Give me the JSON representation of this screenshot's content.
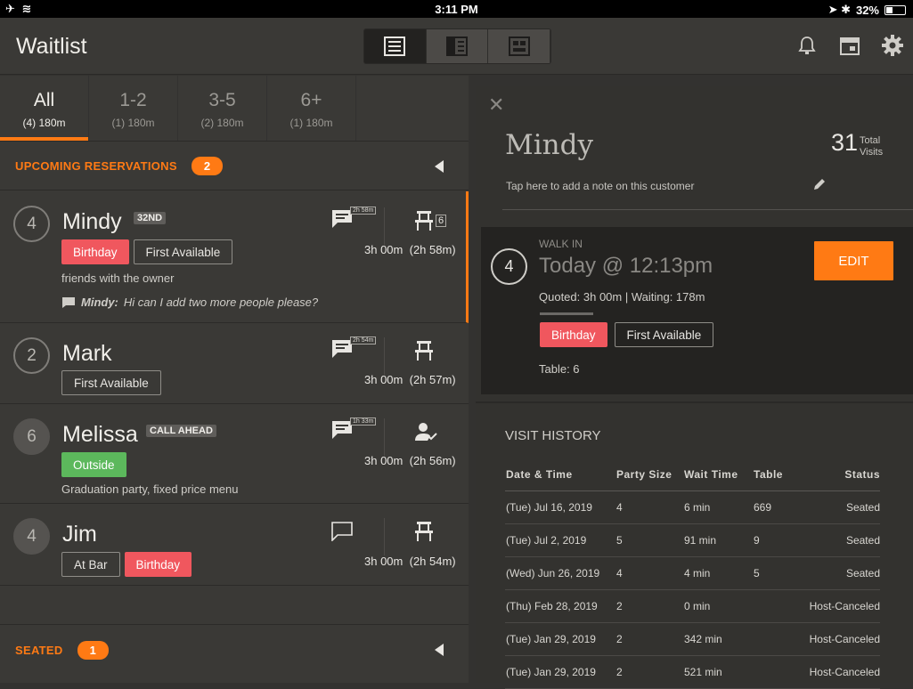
{
  "status_bar": {
    "time": "3:11 PM",
    "battery": "32%"
  },
  "header": {
    "title": "Waitlist"
  },
  "party_tabs": [
    {
      "label": "All",
      "sub": "(4) 180m"
    },
    {
      "label": "1-2",
      "sub": "(1) 180m"
    },
    {
      "label": "3-5",
      "sub": "(2) 180m"
    },
    {
      "label": "6+",
      "sub": "(1) 180m"
    }
  ],
  "upcoming": {
    "label": "UPCOMING RESERVATIONS",
    "count": "2"
  },
  "parties": [
    {
      "size": "4",
      "name": "Mindy",
      "badge": "32ND",
      "tags": [
        "Birthday",
        "First Available"
      ],
      "note": "friends with the owner",
      "msg_name": "Mindy:",
      "msg_text": "Hi can I add two more people please?",
      "chat_time": "2h 58m",
      "table": "6",
      "wait": "3h 00m",
      "elapsed": "(2h 58m)"
    },
    {
      "size": "2",
      "name": "Mark",
      "tags": [
        "First Available"
      ],
      "chat_time": "2h 54m",
      "wait": "3h 00m",
      "elapsed": "(2h 57m)"
    },
    {
      "size": "6",
      "name": "Melissa",
      "badge": "CALL AHEAD",
      "tags": [
        "Outside"
      ],
      "note": "Graduation party, fixed price menu",
      "chat_time": "1h 33m",
      "wait": "3h 00m",
      "elapsed": "(2h 56m)"
    },
    {
      "size": "4",
      "name": "Jim",
      "tags": [
        "At Bar",
        "Birthday"
      ],
      "wait": "3h 00m",
      "elapsed": "(2h 54m)"
    }
  ],
  "seated": {
    "label": "SEATED",
    "count": "1"
  },
  "customer": {
    "name": "Mindy",
    "total_visits": "31",
    "visits_label_1": "Total",
    "visits_label_2": "Visits",
    "note_placeholder": "Tap here to add a note on this customer",
    "walk_in": "WALK IN",
    "when": "Today @ 12:13pm",
    "quoted": "Quoted: 3h 00m | Waiting: 178m",
    "tags": [
      "Birthday",
      "First Available"
    ],
    "table": "Table: 6",
    "party_size": "4",
    "edit_label": "EDIT"
  },
  "visit_history": {
    "title": "VISIT HISTORY",
    "columns": [
      "Date & Time",
      "Party Size",
      "Wait Time",
      "Table",
      "Status"
    ],
    "rows": [
      [
        "(Tue) Jul 16, 2019",
        "4",
        "6 min",
        "669",
        "Seated"
      ],
      [
        "(Tue) Jul 2, 2019",
        "5",
        "91 min",
        "9",
        "Seated"
      ],
      [
        "(Wed) Jun 26, 2019",
        "4",
        "4 min",
        "5",
        "Seated"
      ],
      [
        "(Thu) Feb 28, 2019",
        "2",
        "0 min",
        "",
        "Host-Canceled"
      ],
      [
        "(Tue) Jan 29, 2019",
        "2",
        "342 min",
        "",
        "Host-Canceled"
      ],
      [
        "(Tue) Jan 29, 2019",
        "2",
        "521 min",
        "",
        "Host-Canceled"
      ]
    ]
  },
  "colors": {
    "accent": "#ff7a14",
    "tag_red": "#f0575e",
    "tag_green": "#5cb85c"
  }
}
